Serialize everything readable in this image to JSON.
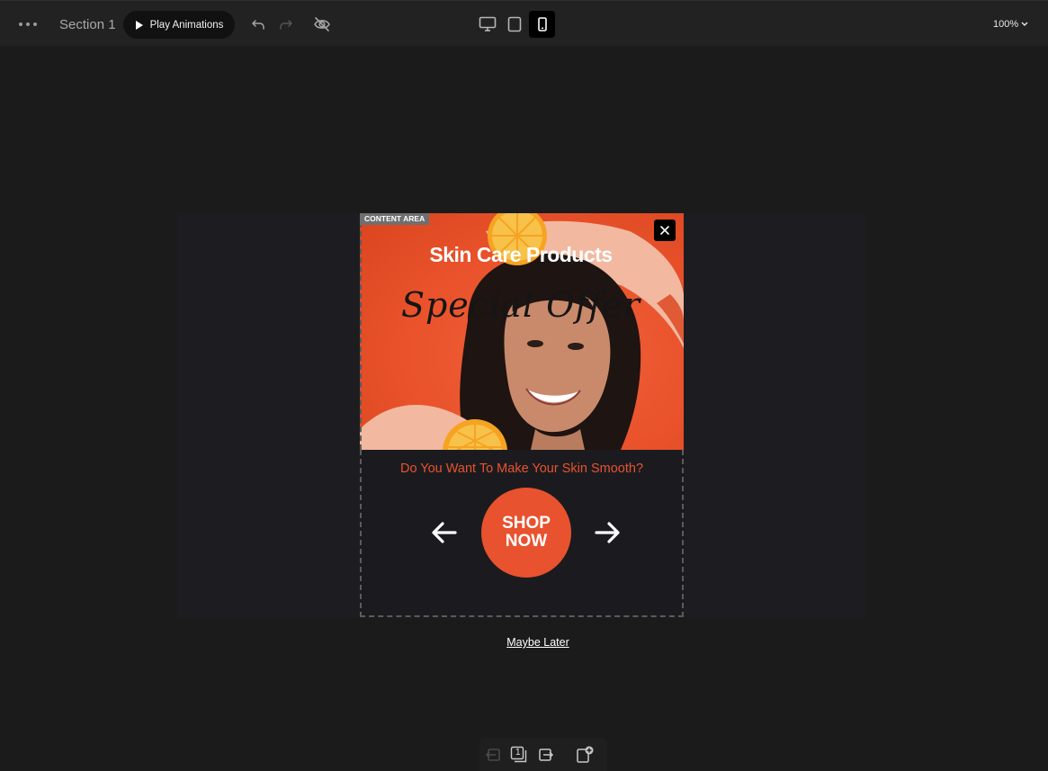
{
  "toolbar": {
    "menu_icon": "more-dots-icon",
    "section_title": "Section 1",
    "play_label": "Play Animations",
    "undo_icon": "undo-icon",
    "redo_icon": "redo-icon",
    "preview_icon": "eye-off-icon",
    "devices": [
      {
        "name": "desktop",
        "icon": "desktop-icon",
        "active": false
      },
      {
        "name": "tablet",
        "icon": "tablet-icon",
        "active": false
      },
      {
        "name": "mobile",
        "icon": "mobile-icon",
        "active": true
      }
    ],
    "zoom": "100%"
  },
  "popup": {
    "content_tag": "CONTENT AREA",
    "close_icon": "close-icon",
    "title": "Skin Care Products",
    "script_text": "Special Offer",
    "question": "Do You Want To Make Your Skin Smooth?",
    "shop_line1": "SHOP",
    "shop_line2": "NOW",
    "prev_icon": "arrow-left-icon",
    "next_icon": "arrow-right-icon",
    "maybe_later": "Maybe Later"
  },
  "bottom_bar": {
    "page_number": "1",
    "icons": [
      "move-left-icon",
      "page-icon",
      "move-right-icon",
      "add-page-icon"
    ]
  },
  "colors": {
    "accent": "#e8522e",
    "toolbar_bg": "#222222",
    "canvas_bg": "#1b1b1b"
  }
}
